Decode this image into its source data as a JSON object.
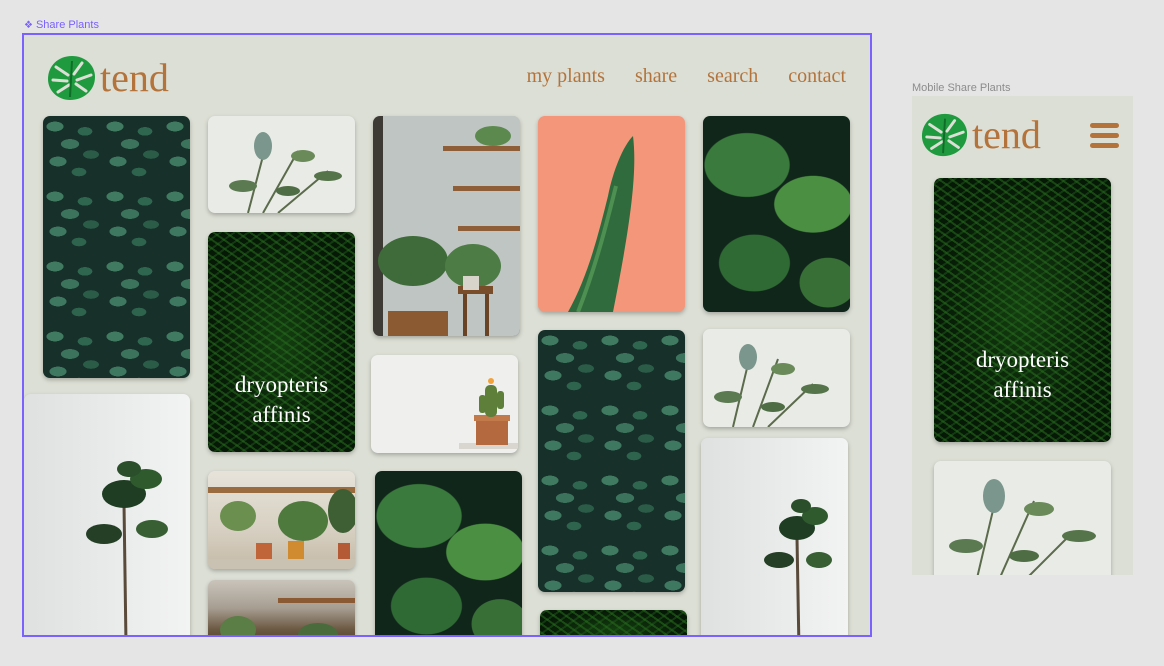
{
  "frames": {
    "desktop_label": "Share Plants",
    "mobile_label": "Mobile Share Plants"
  },
  "brand": {
    "name": "tend"
  },
  "nav": {
    "my_plants": "my plants",
    "share": "share",
    "search": "search",
    "contact": "contact"
  },
  "featured_caption": {
    "line1": "dryopteris",
    "line2": "affinis"
  },
  "colors": {
    "accent": "#b4733b",
    "frame_background": "#dcdfd5",
    "selection": "#7b61ff",
    "logo_leaf": "#1f9a3f"
  },
  "icons": {
    "frame": "component-icon",
    "logo": "monstera-leaf-icon",
    "menu": "hamburger-menu-icon"
  }
}
